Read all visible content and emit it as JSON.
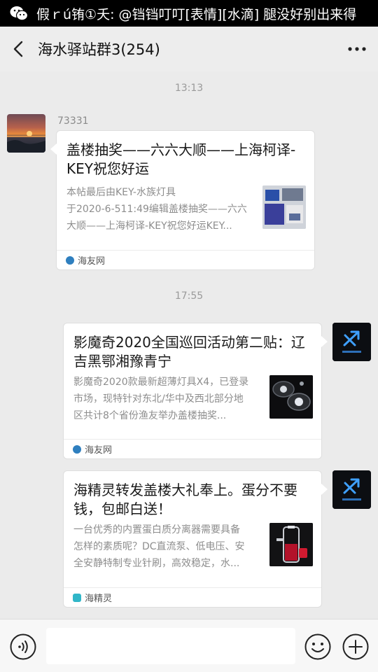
{
  "notification": {
    "text": "假ｒú铕①夭: @铛铛叮叮[表情][水滴] 腿没好别出来得",
    "icon": "wechat-icon"
  },
  "header": {
    "title": "海水驿站群3(254)",
    "back_icon": "back-arrow-icon",
    "more_icon": "more-dots-icon"
  },
  "messages": [
    {
      "time": "13:13",
      "sender": "73331",
      "side": "left",
      "title": "盖楼抽奖——六六大顺——上海柯译-KEY祝您好运",
      "desc": [
        "本帖最后由KEY-水族灯具",
        "于2020-6-511:49编辑盖楼抽奖——六六",
        "大顺——上海柯译-KEY祝您好运KEY..."
      ],
      "source": "海友网"
    },
    {
      "time": "17:55",
      "side": "right",
      "title": "影魔奇2020全国巡回活动第二贴：辽吉黑鄂湘豫青宁",
      "desc": [
        "影魔奇2020款最新超薄灯具X4，已登录",
        "市场，现特针对东北/华中及西北部分地",
        "区共计8个省份渔友举办盖楼抽奖..."
      ],
      "source": "海友网"
    },
    {
      "side": "right",
      "title": "海精灵转发盖楼大礼奉上。蛋分不要钱，包邮白送！",
      "desc": [
        "一台优秀的内置蛋白质分离器需要具备",
        "怎样的素质呢？DC直流泵、低电压、安",
        "全安静特制专业针刷，高效稳定，水..."
      ],
      "source": "海精灵"
    }
  ],
  "input_bar": {
    "voice_icon": "voice-icon",
    "emoji_icon": "emoji-icon",
    "plus_icon": "plus-icon",
    "text_value": ""
  },
  "colors": {
    "background": "#ebebeb",
    "card": "#ffffff",
    "source_blue": "#2f7fbf",
    "source_teal": "#30b6c8"
  }
}
